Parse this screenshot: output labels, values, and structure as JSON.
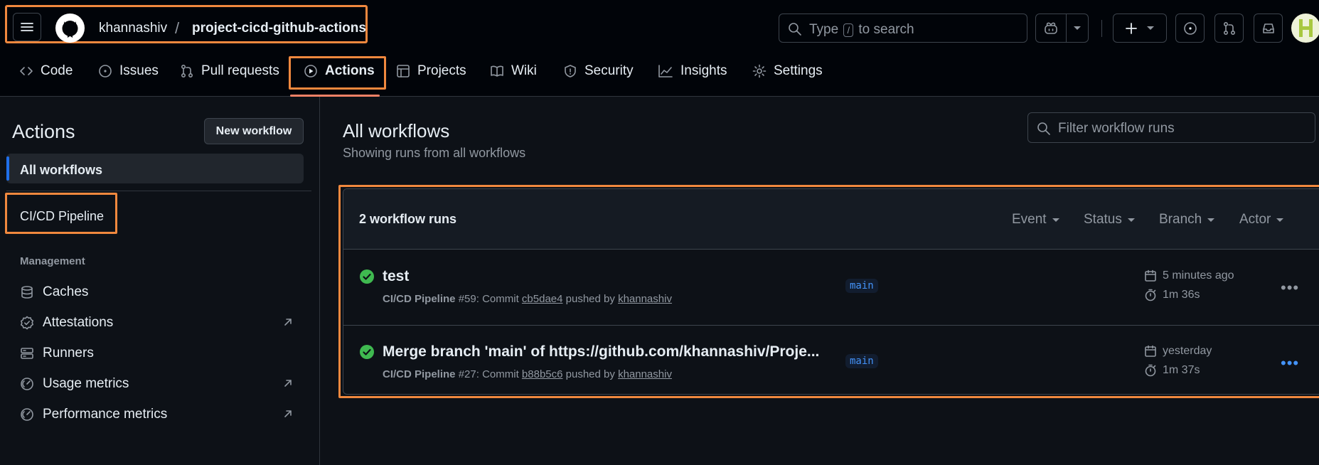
{
  "header": {
    "owner": "khannashiv",
    "separator": "/",
    "repo": "project-cicd-github-actions",
    "search": {
      "prefix": "Type",
      "key": "/",
      "suffix": "to search"
    }
  },
  "nav": {
    "tabs": [
      {
        "label": "Code",
        "icon": "code-icon"
      },
      {
        "label": "Issues",
        "icon": "issue-icon"
      },
      {
        "label": "Pull requests",
        "icon": "pull-request-icon"
      },
      {
        "label": "Actions",
        "icon": "play-icon",
        "selected": true
      },
      {
        "label": "Projects",
        "icon": "table-icon"
      },
      {
        "label": "Wiki",
        "icon": "book-icon"
      },
      {
        "label": "Security",
        "icon": "shield-icon"
      },
      {
        "label": "Insights",
        "icon": "graph-icon"
      },
      {
        "label": "Settings",
        "icon": "gear-icon"
      }
    ]
  },
  "sidebar": {
    "title": "Actions",
    "new_workflow": "New workflow",
    "all_workflows": "All workflows",
    "workflow": "CI/CD Pipeline",
    "management_label": "Management",
    "management": [
      {
        "label": "Caches",
        "icon": "database-icon"
      },
      {
        "label": "Attestations",
        "icon": "verified-icon"
      },
      {
        "label": "Runners",
        "icon": "server-icon"
      },
      {
        "label": "Usage metrics",
        "icon": "meter-icon"
      },
      {
        "label": "Performance metrics",
        "icon": "meter-icon"
      }
    ]
  },
  "main": {
    "title": "All workflows",
    "subtitle": "Showing runs from all workflows",
    "filter_placeholder": "Filter workflow runs",
    "count": "2 workflow runs",
    "filters": [
      "Event",
      "Status",
      "Branch",
      "Actor"
    ],
    "runs": [
      {
        "title": "test",
        "workflow": "CI/CD Pipeline",
        "number": "#59",
        "commit_label": "Commit",
        "commit": "cb5dae4",
        "pushed_by": "pushed by",
        "user": "khannashiv",
        "branch": "main",
        "when": "5 minutes ago",
        "duration": "1m 36s"
      },
      {
        "title": "Merge branch 'main' of https://github.com/khannashiv/Proje...",
        "workflow": "CI/CD Pipeline",
        "number": "#27",
        "commit_label": "Commit",
        "commit": "b88b5c6",
        "pushed_by": "pushed by",
        "user": "khannashiv",
        "branch": "main",
        "when": "yesterday",
        "duration": "1m 37s"
      }
    ]
  },
  "colors": {
    "accent": "#f0883e",
    "success": "#3fb950",
    "link": "#4493f8"
  }
}
